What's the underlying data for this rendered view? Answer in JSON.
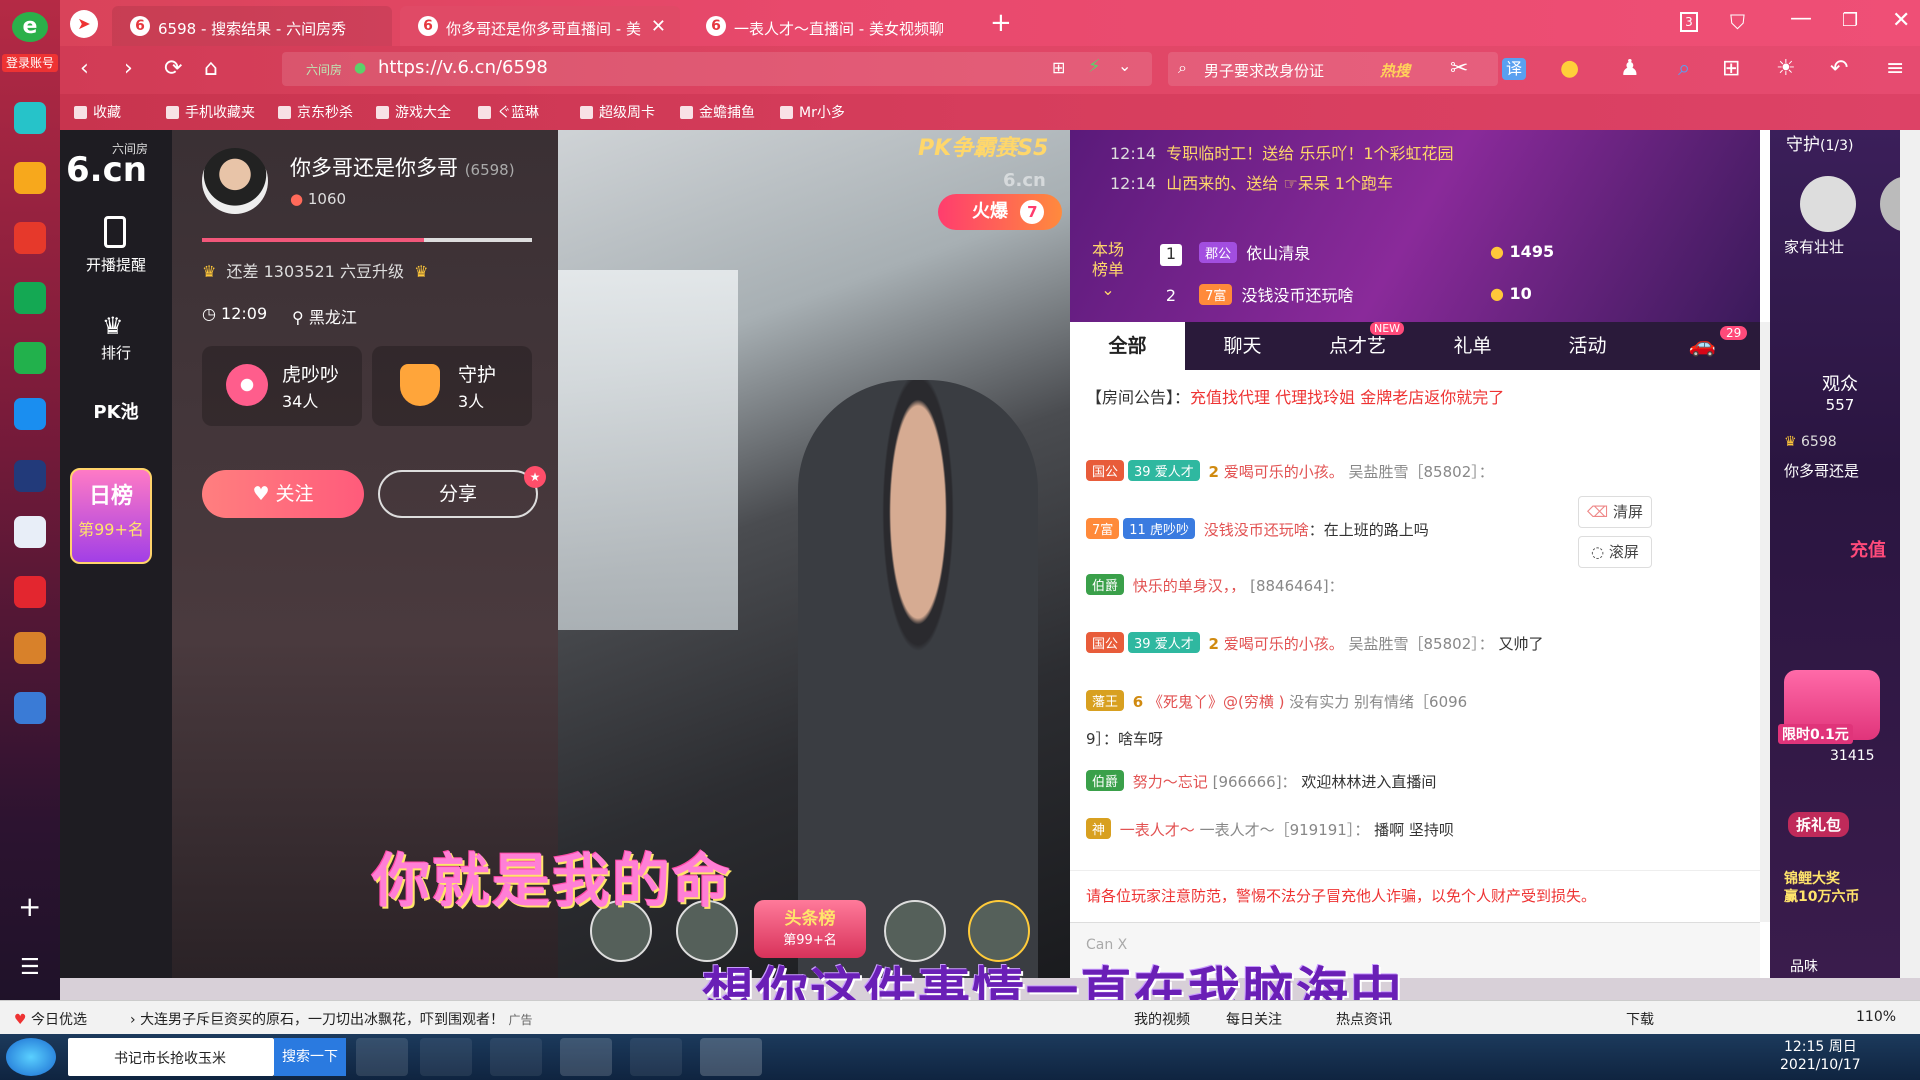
{
  "rail": {
    "login_label": "登录账号"
  },
  "tabs": [
    {
      "label": "6598 - 搜索结果 - 六间房秀"
    },
    {
      "label": "你多哥还是你多哥直播间 - 美"
    },
    {
      "label": "一表人才～直播间 - 美女视频聊"
    }
  ],
  "nav": {
    "url": "https://v.6.cn/6598",
    "url_prefix": "六间房",
    "search": "男子要求改身份证",
    "hot": "热搜"
  },
  "bookmarks": [
    "收藏",
    "手机收藏夹",
    "京东秒杀",
    "游戏大全",
    "ぐ蓝琳",
    "超级周卡",
    "金蟾捕鱼",
    "Mr小多"
  ],
  "sidenav": {
    "logo_top": "六间房",
    "logo_main": "6.cn",
    "items": [
      "开播提醒",
      "排行",
      "PK池"
    ],
    "rank_title": "日榜",
    "rank_value": "第99+名"
  },
  "host": {
    "name": "你多哥还是你多哥",
    "id": "(6598)",
    "fans": "1060",
    "upgrade": "还差 1303521 六豆升级",
    "time": "12:09",
    "location": "黑龙江",
    "group1_name": "虎吵吵",
    "group1_count": "34人",
    "group2_name": "守护",
    "group2_count": "3人",
    "follow": "关注",
    "share": "分享"
  },
  "video": {
    "pk_banner": "PK争霸赛S5",
    "hot_label": "火爆",
    "hot_num": "7",
    "watermark": "6.cn",
    "subtitle1": "你就是我的命",
    "subtitle2": "想你这件事情一直在我脑海中",
    "headline": "头条榜",
    "headline_rank": "第99+名"
  },
  "top": {
    "gift_lines": [
      {
        "time": "12:14",
        "text": "专职临时工！送给 乐乐吖！1个彩虹花园"
      },
      {
        "time": "12:14",
        "text": "山西来的、送给 ☞呆呆 1个跑车"
      }
    ],
    "board_label_1": "本场",
    "board_label_2": "榜单",
    "board": [
      {
        "rank": "1",
        "badge": "郡公",
        "name": "依山清泉",
        "coins": "1495"
      },
      {
        "rank": "2",
        "badge": "7富",
        "name": "没钱没币还玩啥",
        "coins": "10"
      }
    ]
  },
  "chat": {
    "tabs": [
      "全部",
      "聊天",
      "点才艺",
      "礼单",
      "活动"
    ],
    "new_tag": "NEW",
    "car_count": "29",
    "notice_label": "【房间公告】：",
    "notice": "充值找代理 代理找玲姐 金牌老店返你就完了",
    "messages": [
      {
        "badge": "国公",
        "level": "39",
        "group": "爱人才",
        "num": "2",
        "user": "爱喝可乐的小孩。",
        "target": "吴盐胜雪［85802］：",
        "text": ""
      },
      {
        "badge": "7富",
        "level": "11",
        "group": "虎吵吵",
        "user": "没钱没币还玩啥",
        "text": "：在上班的路上吗"
      },
      {
        "badge": "伯爵",
        "user": "快乐的单身汉，，",
        "target": "[8846464]：",
        "text": ""
      },
      {
        "badge": "国公",
        "level": "39",
        "group": "爱人才",
        "num": "2",
        "user": "爱喝可乐的小孩。",
        "target": "吴盐胜雪［85802］：",
        "text": "又帅了"
      },
      {
        "badge": "藩王",
        "num": "6",
        "user": "《死鬼丫》@(穷横 )",
        "target": "没有实力 别有情绪［6096",
        "text": "9］：啥车呀"
      },
      {
        "badge": "伯爵",
        "user": "努力～忘记",
        "target": "[966666]：",
        "text": "欢迎林林进入直播间"
      },
      {
        "badge": "神",
        "user": "一表人才～",
        "target": "一表人才～［919191］：",
        "text": "播啊 坚持呗"
      }
    ],
    "clear": "清屏",
    "scroll": "滚屏",
    "warning": "请各位玩家注意防范，警惕不法分子冒充他人诈骗，以免个人财产受到损失。",
    "input_hint": "Can X"
  },
  "right": {
    "guard_title": "守护",
    "guard_count": "(1/3)",
    "guard_name": "家有壮壮",
    "audience_label": "观众",
    "audience_count": "557",
    "aud_id": "6598",
    "aud_name": "你多哥还是",
    "promo1": "充值",
    "promo2": "限时0.1元",
    "promo3": "拆礼包",
    "promo4": "锦鲤大奖",
    "promo5": "赢10万六币",
    "aud2": "品味",
    "num2": "31415"
  },
  "status": {
    "daily": "今日优选",
    "news": "大连男子斥巨资买的原石，一刀切出冰飘花，吓到围观者！",
    "ad": "广告",
    "links": [
      "我的视频",
      "每日关注",
      "热点资讯",
      "下载"
    ],
    "zoom": "110%"
  },
  "taskbar": {
    "search_text": "书记市长抢收玉米",
    "search_btn": "搜索一下",
    "time": "12:15 周日",
    "date": "2021/10/17"
  }
}
